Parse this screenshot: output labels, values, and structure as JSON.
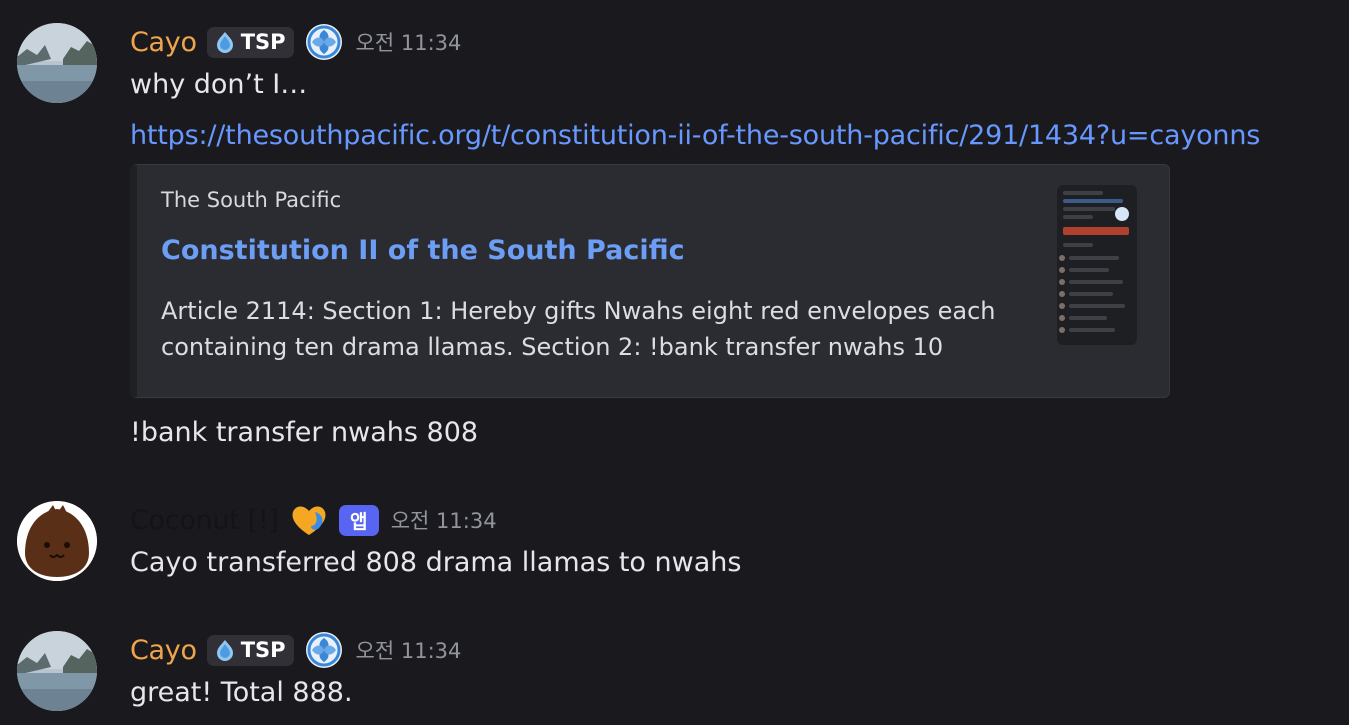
{
  "messages": [
    {
      "author": "Cayo",
      "tag": "TSP",
      "timestamp": "오전 11:34",
      "lines": [
        "why don’t I…"
      ],
      "link": "https://thesouthpacific.org/t/constitution-ii-of-the-south-pacific/291/1434?u=cayonns",
      "embed": {
        "provider": "The South Pacific",
        "title": "Constitution II of the South Pacific",
        "description_line1": "Article 2114: Section 1: Hereby gifts Nwahs eight red envelopes each",
        "description_line2": "containing ten drama llamas. Section 2: !bank transfer nwahs 10"
      },
      "after": "!bank transfer nwahs 808"
    },
    {
      "author": "Coconut [!]",
      "app_badge": "앱",
      "timestamp": "오전 11:34",
      "text": "Cayo transferred 808 drama llamas to nwahs"
    },
    {
      "author": "Cayo",
      "tag": "TSP",
      "timestamp": "오전 11:34",
      "text": "great! Total 888."
    }
  ],
  "colors": {
    "background": "#1a1a1e",
    "cayo_name": "#f0a54a",
    "link": "#6898ff",
    "app_badge": "#5865f2"
  },
  "icons": [
    "tsp-tag-icon",
    "role-emblem-icon",
    "heart-role-icon",
    "cayo-avatar",
    "coconut-avatar"
  ]
}
